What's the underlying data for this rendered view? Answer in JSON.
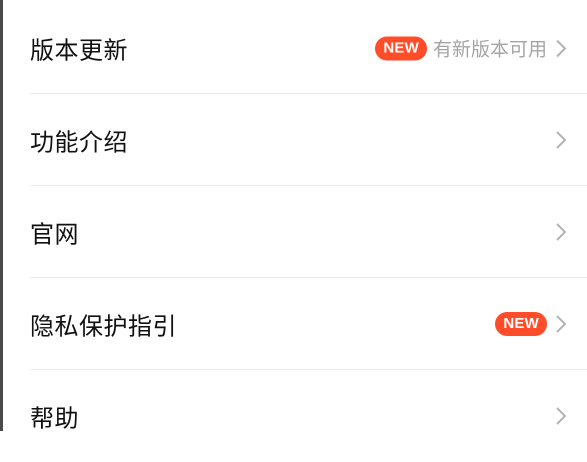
{
  "colors": {
    "badge_bg": "#ff4d29",
    "badge_text": "#ffffff",
    "label_text": "#111111",
    "secondary_text": "#a5a5a5",
    "chevron": "#b3b3b3",
    "divider": "#ececec"
  },
  "settings_list": {
    "items": [
      {
        "label": "版本更新",
        "badge": "NEW",
        "status": "有新版本可用",
        "icon": "chevron-right-icon"
      },
      {
        "label": "功能介绍",
        "icon": "chevron-right-icon"
      },
      {
        "label": "官网",
        "icon": "chevron-right-icon"
      },
      {
        "label": "隐私保护指引",
        "badge": "NEW",
        "icon": "chevron-right-icon"
      },
      {
        "label": "帮助",
        "icon": "chevron-right-icon"
      }
    ]
  }
}
